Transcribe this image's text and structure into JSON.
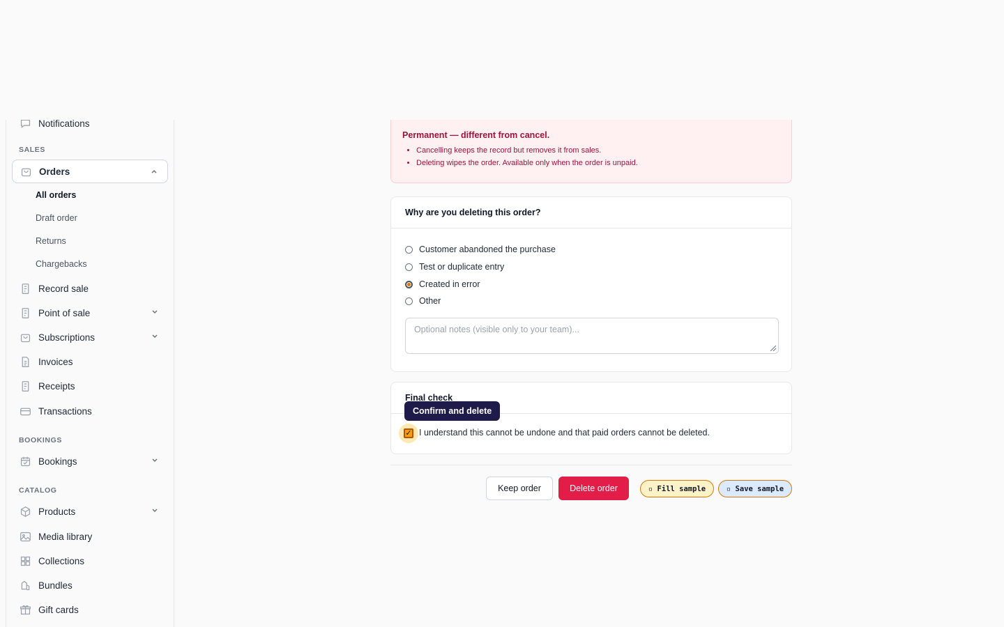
{
  "sidebar": {
    "partial_item": {
      "label": "Notifications",
      "icon": "chat-icon"
    },
    "sections": {
      "sales": "SALES",
      "bookings": "BOOKINGS",
      "catalog": "CATALOG"
    },
    "orders": {
      "label": "Orders",
      "icon": "shopping-bag-icon",
      "expanded": true
    },
    "order_subitems": [
      "All orders",
      "Draft order",
      "Returns",
      "Chargebacks"
    ],
    "sales_items": [
      {
        "label": "Record sale",
        "icon": "receipt-icon"
      },
      {
        "label": "Point of sale",
        "icon": "receipt-icon",
        "has_chevron": true
      },
      {
        "label": "Subscriptions",
        "icon": "shopping-bag-icon",
        "has_chevron": true
      },
      {
        "label": "Invoices",
        "icon": "document-icon"
      },
      {
        "label": "Receipts",
        "icon": "receipt-icon"
      },
      {
        "label": "Transactions",
        "icon": "credit-card-icon"
      }
    ],
    "bookings_items": [
      {
        "label": "Bookings",
        "icon": "calendar-icon",
        "has_chevron": true
      }
    ],
    "catalog_items": [
      {
        "label": "Products",
        "icon": "cube-icon",
        "has_chevron": true
      },
      {
        "label": "Media library",
        "icon": "image-icon"
      },
      {
        "label": "Collections",
        "icon": "grid-icon"
      },
      {
        "label": "Bundles",
        "icon": "bundle-icon"
      },
      {
        "label": "Gift cards",
        "icon": "gift-icon"
      }
    ]
  },
  "alert": {
    "title": "Permanent — different from cancel.",
    "bullets": [
      "Cancelling keeps the record but removes it from sales.",
      "Deleting wipes the order. Available only when the order is unpaid."
    ]
  },
  "reason_card": {
    "title": "Why are you deleting this order?",
    "options": [
      {
        "label": "Customer abandoned the purchase",
        "selected": false
      },
      {
        "label": "Test or duplicate entry",
        "selected": false
      },
      {
        "label": "Created in error",
        "selected": true
      },
      {
        "label": "Other",
        "selected": false
      }
    ],
    "notes_placeholder": "Optional notes (visible only to your team)..."
  },
  "final_check": {
    "title": "Final check",
    "tooltip": "Confirm and delete",
    "checkbox_label": "I understand this cannot be undone and that paid orders cannot be deleted.",
    "checked": true
  },
  "actions": {
    "keep": "Keep order",
    "delete": "Delete order",
    "fill_sample": "Fill sample",
    "save_sample": "Save sample"
  },
  "colors": {
    "danger": "#e11d48",
    "alert_bg": "#fff1f2",
    "tooltip_bg": "#1e1b4b",
    "accent_amber": "#f59e0b"
  }
}
